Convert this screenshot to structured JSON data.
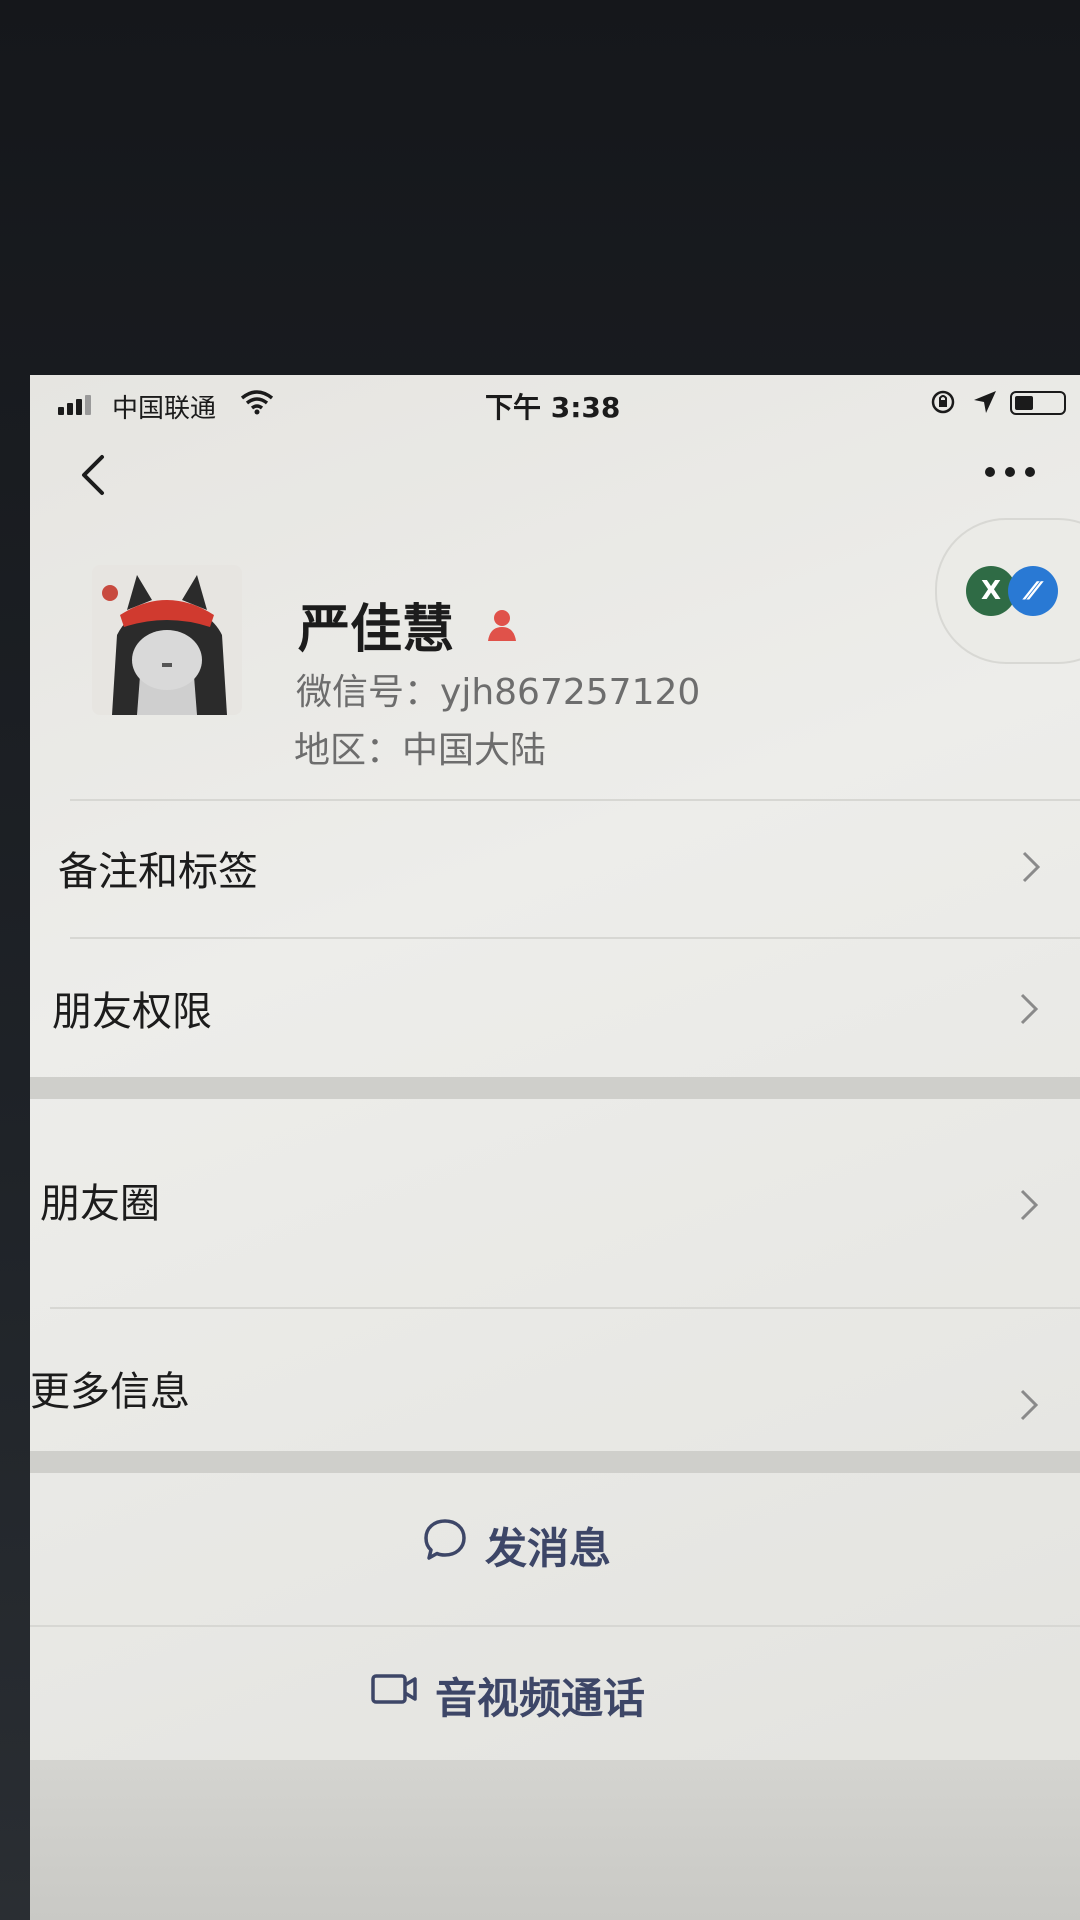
{
  "status_bar": {
    "carrier": "中国联通",
    "time": "下午 3:38"
  },
  "profile": {
    "name": "严佳慧",
    "wechat_id_label": "微信号：",
    "wechat_id": "yjh867257120",
    "region_label": "地区：",
    "region": "中国大陆"
  },
  "badges": {
    "first": "X"
  },
  "menu": {
    "remarks_tags": "备注和标签",
    "friend_permissions": "朋友权限",
    "moments": "朋友圈",
    "more_info": "更多信息"
  },
  "actions": {
    "send_message": "发消息",
    "video_call": "音视频通话"
  },
  "colors": {
    "accent_text": "#3d4667",
    "gender_icon": "#e0524a",
    "badge_green": "#2f6b45",
    "badge_blue": "#2979d4"
  }
}
